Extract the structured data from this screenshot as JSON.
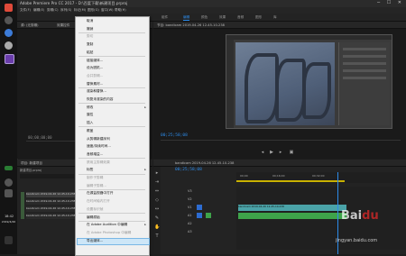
{
  "window": {
    "title": "Adobe Premiere Pro CC 2017 - D:\\百度下载\\新建项目.prproj"
  },
  "menubar": [
    "文件(F)",
    "编辑(E)",
    "剪辑(C)",
    "序列(S)",
    "标记(M)",
    "图形(G)",
    "窗口(W)",
    "帮助(H)"
  ],
  "workspaces": [
    "组件",
    "编辑",
    "颜色",
    "效果",
    "音频",
    "图形",
    "库"
  ],
  "source": {
    "header": "源: (无剪辑)",
    "effects_tab": "效果控件",
    "timecode": "00;00;00;00"
  },
  "program": {
    "header": "节目: bandicam 2019-04-26 12-45-10-238",
    "timecode": "00;25;58;08"
  },
  "project": {
    "header": "项目: 新建项目",
    "search_placeholder": "新建项目.prproj",
    "files": [
      "bandicam 2019-04-26 12-45-10-238",
      "bandicam 2019-04-26 12-45-10-238",
      "bandicam 2019-04-26 12-45-10-238",
      "bandicam 2019-04-26 12-45-10-238"
    ]
  },
  "timeline": {
    "header": "bandicam 2019-04-26 12-45-10-238",
    "timecode": "00;25;58;08",
    "ruler": [
      "00;00",
      "00;16;00",
      "00;32;00"
    ],
    "tracks": [
      "V3",
      "V2",
      "V1",
      "A1",
      "A2",
      "A3"
    ],
    "clip_label": "bandicam 2019-04-26 12-45-10-238"
  },
  "taskbar": {
    "time": "18:42",
    "date": "2019/4/26"
  },
  "context_menu": {
    "items": [
      {
        "label": "取消",
        "disabled": false
      },
      {
        "label": "撤销",
        "disabled": false
      },
      {
        "label": "剪切",
        "disabled": true
      },
      {
        "label": "复制",
        "disabled": false
      },
      {
        "label": "粘贴",
        "disabled": false
      },
      {
        "label": "链接媒体...",
        "disabled": false
      },
      {
        "label": "设为脱机...",
        "disabled": false
      },
      {
        "label": "合并剪辑...",
        "disabled": true
      },
      {
        "label": "替换素材...",
        "disabled": false
      },
      {
        "label": "渲染和替换...",
        "disabled": false
      },
      {
        "label": "恢复未渲染的内容",
        "disabled": false
      },
      {
        "label": "修改",
        "disabled": false,
        "submenu": true
      },
      {
        "label": "属性",
        "disabled": false
      },
      {
        "label": "插入",
        "disabled": false
      },
      {
        "label": "覆盖",
        "disabled": false
      },
      {
        "label": "从剪辑新建序列",
        "disabled": false
      },
      {
        "label": "速度/持续时间...",
        "disabled": false
      },
      {
        "label": "音频增益...",
        "disabled": false
      },
      {
        "label": "禁用主剪辑效果",
        "disabled": true
      },
      {
        "label": "标签",
        "disabled": false,
        "submenu": true
      },
      {
        "label": "制作子剪辑",
        "disabled": true
      },
      {
        "label": "编辑子剪辑...",
        "disabled": true
      },
      {
        "label": "在源监视器中打开",
        "disabled": false
      },
      {
        "label": "在时间轴内打开",
        "disabled": true
      },
      {
        "label": "设置标识帧",
        "disabled": true
      },
      {
        "label": "编辑原始",
        "disabled": false
      },
      {
        "label": "在 Adobe Audition 中编辑",
        "disabled": false,
        "submenu": true
      },
      {
        "label": "在 Adobe Photoshop 中编辑",
        "disabled": true
      },
      {
        "label": "导出媒体...",
        "disabled": false,
        "highlighted": true
      }
    ]
  },
  "colors": {
    "accent": "#2d8ceb",
    "clip_video": "#4aa3a8",
    "clip_audio": "#3ea34a",
    "playhead": "#2d8ceb",
    "taskbar": "#141414"
  }
}
